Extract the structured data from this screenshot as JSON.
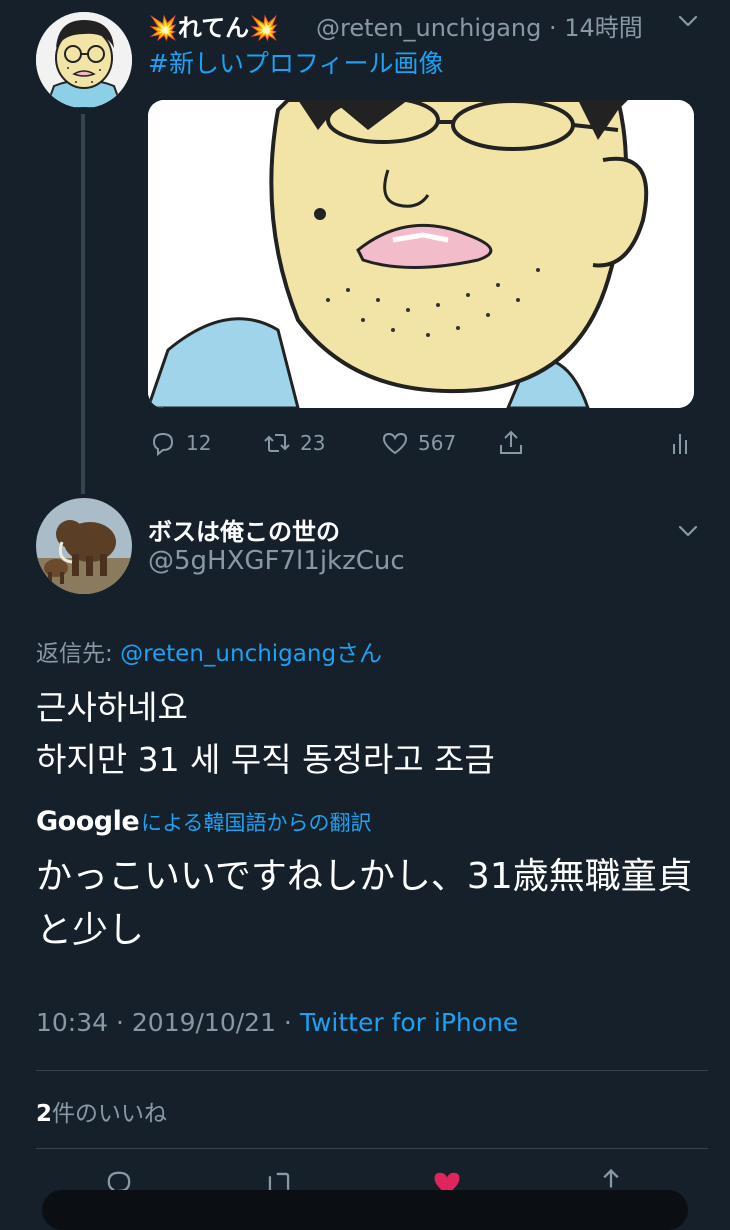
{
  "tweet1": {
    "avatar_icon": "cartoon-man-glasses-avatar",
    "display_name": "💥れてん💥",
    "handle": "@reten_unchigang",
    "time": "14時間",
    "hashtag": "#新しいプロフィール画像",
    "media_description": "cartoon-man-glasses-image",
    "actions": {
      "reply_count": "12",
      "retweet_count": "23",
      "like_count": "567"
    }
  },
  "tweet2": {
    "avatar_icon": "mammoth-avatar",
    "display_name": "ボスは俺この世の",
    "handle": "@5gHXGF7l1jkzCuc",
    "reply_to_prefix": "返信先: ",
    "reply_to_handle": "@reten_unchigangさん",
    "body_lines": [
      "근사하네요",
      "하지만 31 세 무직 동정라고 조금"
    ],
    "translation_brand": "Google",
    "translation_label": "による韓国語からの翻訳",
    "translated_text": "かっこいいですねしかし、31歳無職童貞と少し",
    "timestamp": "10:34 · 2019/10/21 · ",
    "source": "Twitter for iPhone",
    "likes_count": "2",
    "likes_label": "件のいいね"
  },
  "colors": {
    "background": "#15202b",
    "accent": "#1da1f2",
    "muted": "#8899a6",
    "divider": "#38444d",
    "like_red": "#e0245e"
  }
}
